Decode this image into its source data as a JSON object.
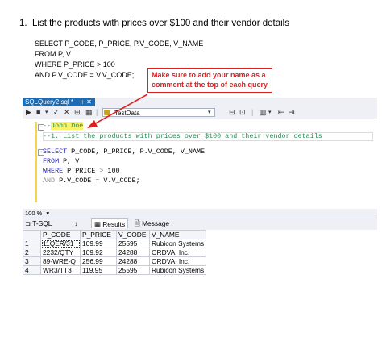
{
  "document": {
    "heading_number": "1.",
    "heading_text": "List the products with prices over $100 and their vendor details",
    "sql_lines": [
      "SELECT P_CODE, P_PRICE, P.V_CODE, V_NAME",
      "FROM P, V",
      "WHERE P_PRICE > 100",
      "AND P.V_CODE = V.V_CODE;"
    ]
  },
  "callout": {
    "line1": "Make sure to add your name as a",
    "line2": "comment at the top of each query",
    "color": "#e02020"
  },
  "window": {
    "file_tab": "SQLQuery2.sql *",
    "pin_icon": "pin-icon",
    "close_icon": "close-icon",
    "database": "TestData",
    "toolbar_icons": [
      "execute-arrow-icon",
      "stop-icon",
      "checkmark-icon",
      "cancel-icon",
      "plan-icon",
      "results-grid-icon",
      "comment-icon",
      "uncomment-icon"
    ]
  },
  "editor": {
    "comment_name_prefix": "--",
    "comment_name": "John Doe",
    "comment_line": "--1. List the products with prices over $100 and their vendor details",
    "sql": {
      "select_kw": "SELECT",
      "select_rest": " P_CODE, P_PRICE, P.V_CODE, V_NAME",
      "from_kw": "FROM",
      "from_rest": " P, V",
      "where_kw": "WHERE",
      "where_rest": " P_PRICE ",
      "where_op": ">",
      "where_val": " 100",
      "and_kw": "AND",
      "and_rest": " P.V_CODE ",
      "and_op": "=",
      "and_val": " V.V_CODE;"
    }
  },
  "status": {
    "zoom": "100 %",
    "zoom_arrow": "▾"
  },
  "results_tabs": {
    "tsql_label": "T-SQL",
    "sort_label": "↑↓",
    "results_label": "Results",
    "messages_label": "Message"
  },
  "results": {
    "columns": [
      "P_CODE",
      "P_PRICE",
      "V_CODE",
      "V_NAME"
    ],
    "rows": [
      {
        "n": "1",
        "cells": [
          "11QER/31",
          "109.99",
          "25595",
          "Rubicon Systems"
        ]
      },
      {
        "n": "2",
        "cells": [
          "2232/QTY",
          "109.92",
          "24288",
          "ORDVA, Inc."
        ]
      },
      {
        "n": "3",
        "cells": [
          "89-WRE-Q",
          "256.99",
          "24288",
          "ORDVA, Inc."
        ]
      },
      {
        "n": "4",
        "cells": [
          "WR3/TT3",
          "119.95",
          "25595",
          "Rubicon Systems"
        ]
      }
    ]
  },
  "colors": {
    "tab_active": "#1c6bb5",
    "keyword": "#1a1acc",
    "comment": "#2e8b57",
    "highlight": "#f7f36a"
  }
}
